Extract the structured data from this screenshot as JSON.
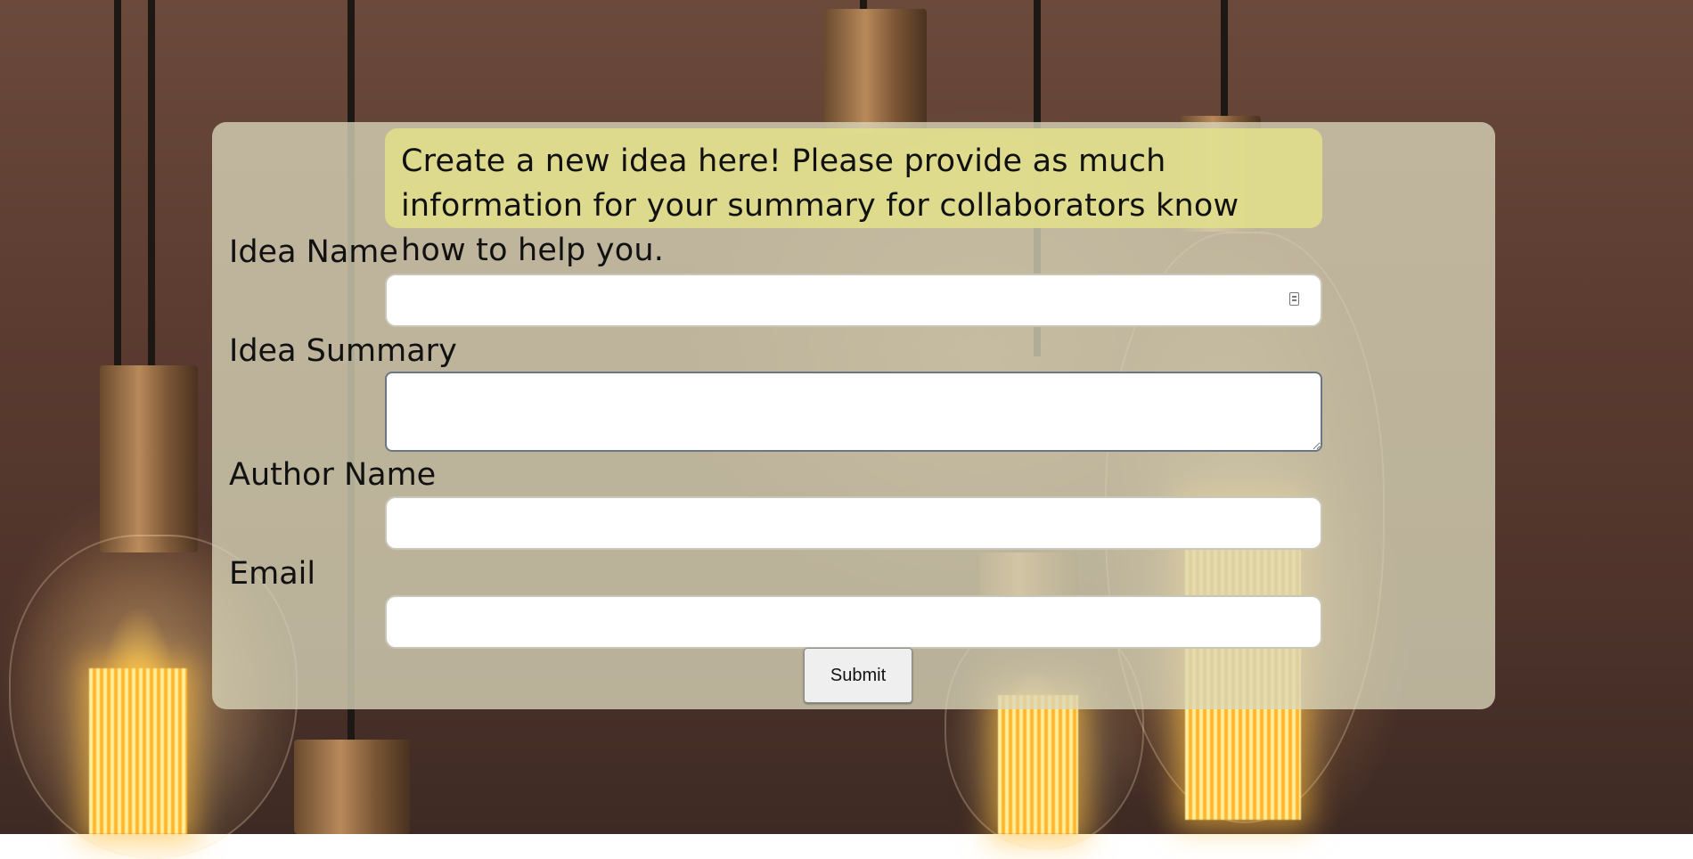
{
  "intro_text": "Create a new idea here! Please provide as much information for your summary for collaborators know how to help you.",
  "form": {
    "idea_name_label": "Idea Name",
    "idea_name_value": "",
    "idea_summary_label": "Idea Summary",
    "idea_summary_value": "",
    "author_name_label": "Author Name",
    "author_name_value": "",
    "email_label": "Email",
    "email_value": "",
    "submit_label": "Submit"
  },
  "icons": {
    "idea_name_field_icon": "autofill-contact-icon"
  },
  "colors": {
    "panel": "#dad6ba",
    "intro_box": "#e1dd8c",
    "input_bg": "#ffffff",
    "button_bg": "#efefef"
  }
}
